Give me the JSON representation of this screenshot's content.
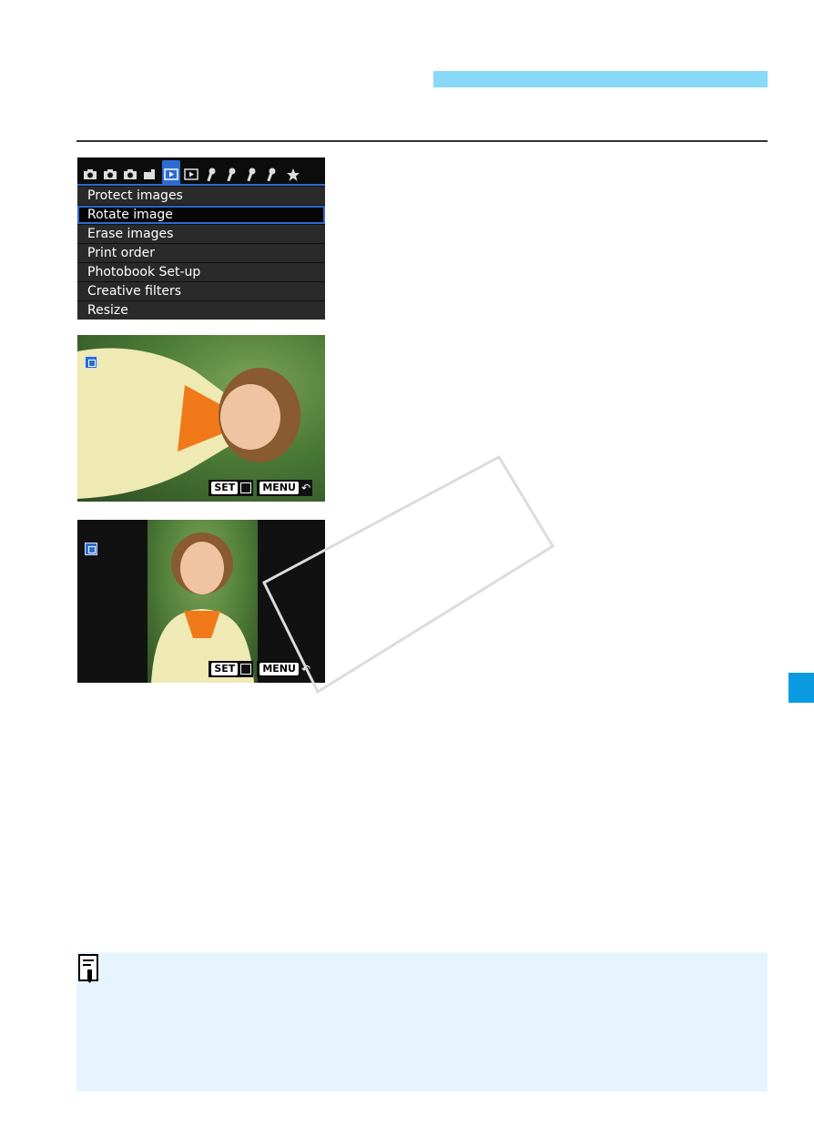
{
  "menu": {
    "items": [
      {
        "label": "Protect images"
      },
      {
        "label": "Rotate image"
      },
      {
        "label": "Erase images"
      },
      {
        "label": "Print order"
      },
      {
        "label": "Photobook Set-up"
      },
      {
        "label": "Creative filters"
      },
      {
        "label": "Resize"
      }
    ],
    "selected_index": 1,
    "tab_icons": [
      "camera-tab-icon",
      "camera-tab-icon",
      "camera-tab-icon",
      "camera-tab-icon",
      "playback-tab-icon",
      "playback-tab-icon",
      "wrench-tab-icon",
      "wrench-tab-icon",
      "wrench-tab-icon",
      "wrench-tab-icon",
      "star-tab-icon"
    ],
    "active_tab_index": 4
  },
  "playback": {
    "set_label": "SET",
    "menu_label": "MENU",
    "back_glyph": "↶"
  },
  "colors": {
    "header_bar": "#88d9f7",
    "menu_accent": "#2d6bd0",
    "side_tab": "#0b9be0",
    "note_box": "#e6f5fd"
  }
}
